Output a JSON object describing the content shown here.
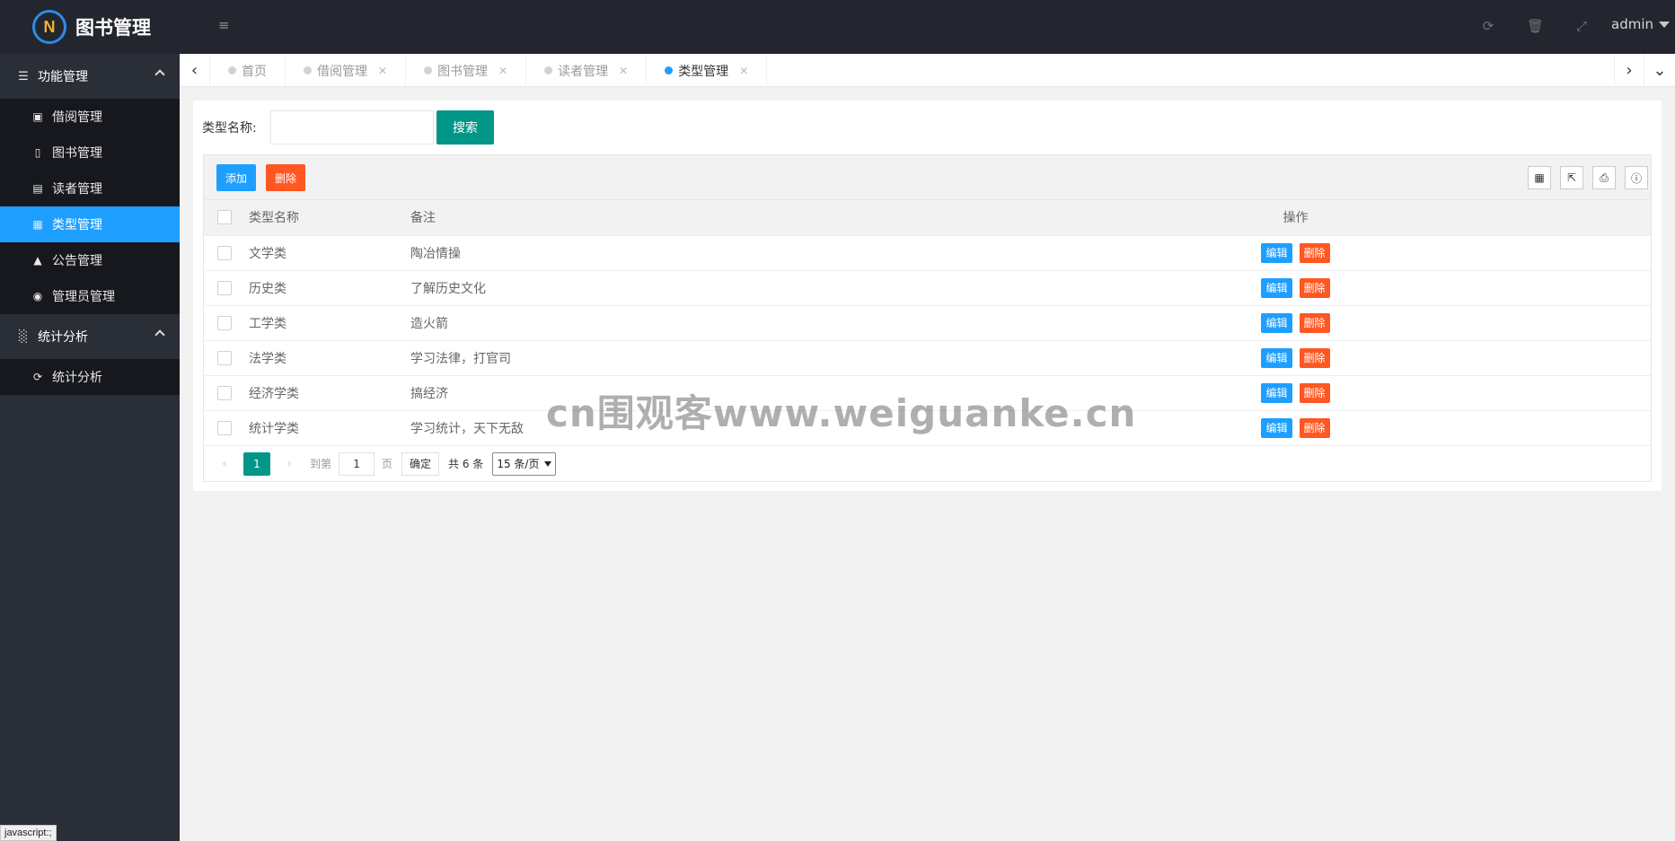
{
  "header": {
    "logo_text": "图书管理",
    "menu_toggle_icon": "menu-toggle-icon",
    "icons": [
      "refresh-icon",
      "trash-icon",
      "fullscreen-icon"
    ],
    "user": "admin"
  },
  "sidebar": {
    "groups": [
      {
        "label": "功能管理",
        "icon": "list-icon",
        "items": [
          {
            "label": "借阅管理",
            "icon": "window-icon"
          },
          {
            "label": "图书管理",
            "icon": "book-icon"
          },
          {
            "label": "读者管理",
            "icon": "card-icon"
          },
          {
            "label": "类型管理",
            "icon": "file-icon",
            "active": true
          },
          {
            "label": "公告管理",
            "icon": "bell-icon"
          },
          {
            "label": "管理员管理",
            "icon": "user-circle-icon"
          }
        ]
      },
      {
        "label": "统计分析",
        "icon": "bar-chart-icon",
        "items": [
          {
            "label": "统计分析",
            "icon": "refresh-icon"
          }
        ]
      }
    ],
    "status_tip": "javascript:;"
  },
  "tabs": [
    {
      "label": "首页",
      "closable": false,
      "active": false
    },
    {
      "label": "借阅管理",
      "closable": true,
      "active": false
    },
    {
      "label": "图书管理",
      "closable": true,
      "active": false
    },
    {
      "label": "读者管理",
      "closable": true,
      "active": false
    },
    {
      "label": "类型管理",
      "closable": true,
      "active": true
    }
  ],
  "search": {
    "label": "类型名称:",
    "value": "",
    "button": "搜索"
  },
  "toolbar": {
    "add_label": "添加",
    "delete_label": "删除",
    "icons": [
      "columns-icon",
      "export-icon",
      "print-icon",
      "info-icon"
    ]
  },
  "table": {
    "headers": [
      "类型名称",
      "备注",
      "操作"
    ],
    "rows": [
      {
        "name": "文学类",
        "note": "陶冶情操"
      },
      {
        "name": "历史类",
        "note": "了解历史文化"
      },
      {
        "name": "工学类",
        "note": "造火箭"
      },
      {
        "name": "法学类",
        "note": "学习法律，打官司"
      },
      {
        "name": "经济学类",
        "note": "搞经济"
      },
      {
        "name": "统计学类",
        "note": "学习统计，天下无敌"
      }
    ],
    "edit_label": "编辑",
    "delete_label": "删除"
  },
  "pagination": {
    "current": "1",
    "goto_label": "到第",
    "goto_value": "1",
    "page_unit": "页",
    "confirm": "确定",
    "total": "共 6 条",
    "page_size": "15 条/页"
  },
  "watermark": "cn围观客www.weiguanke.cn"
}
